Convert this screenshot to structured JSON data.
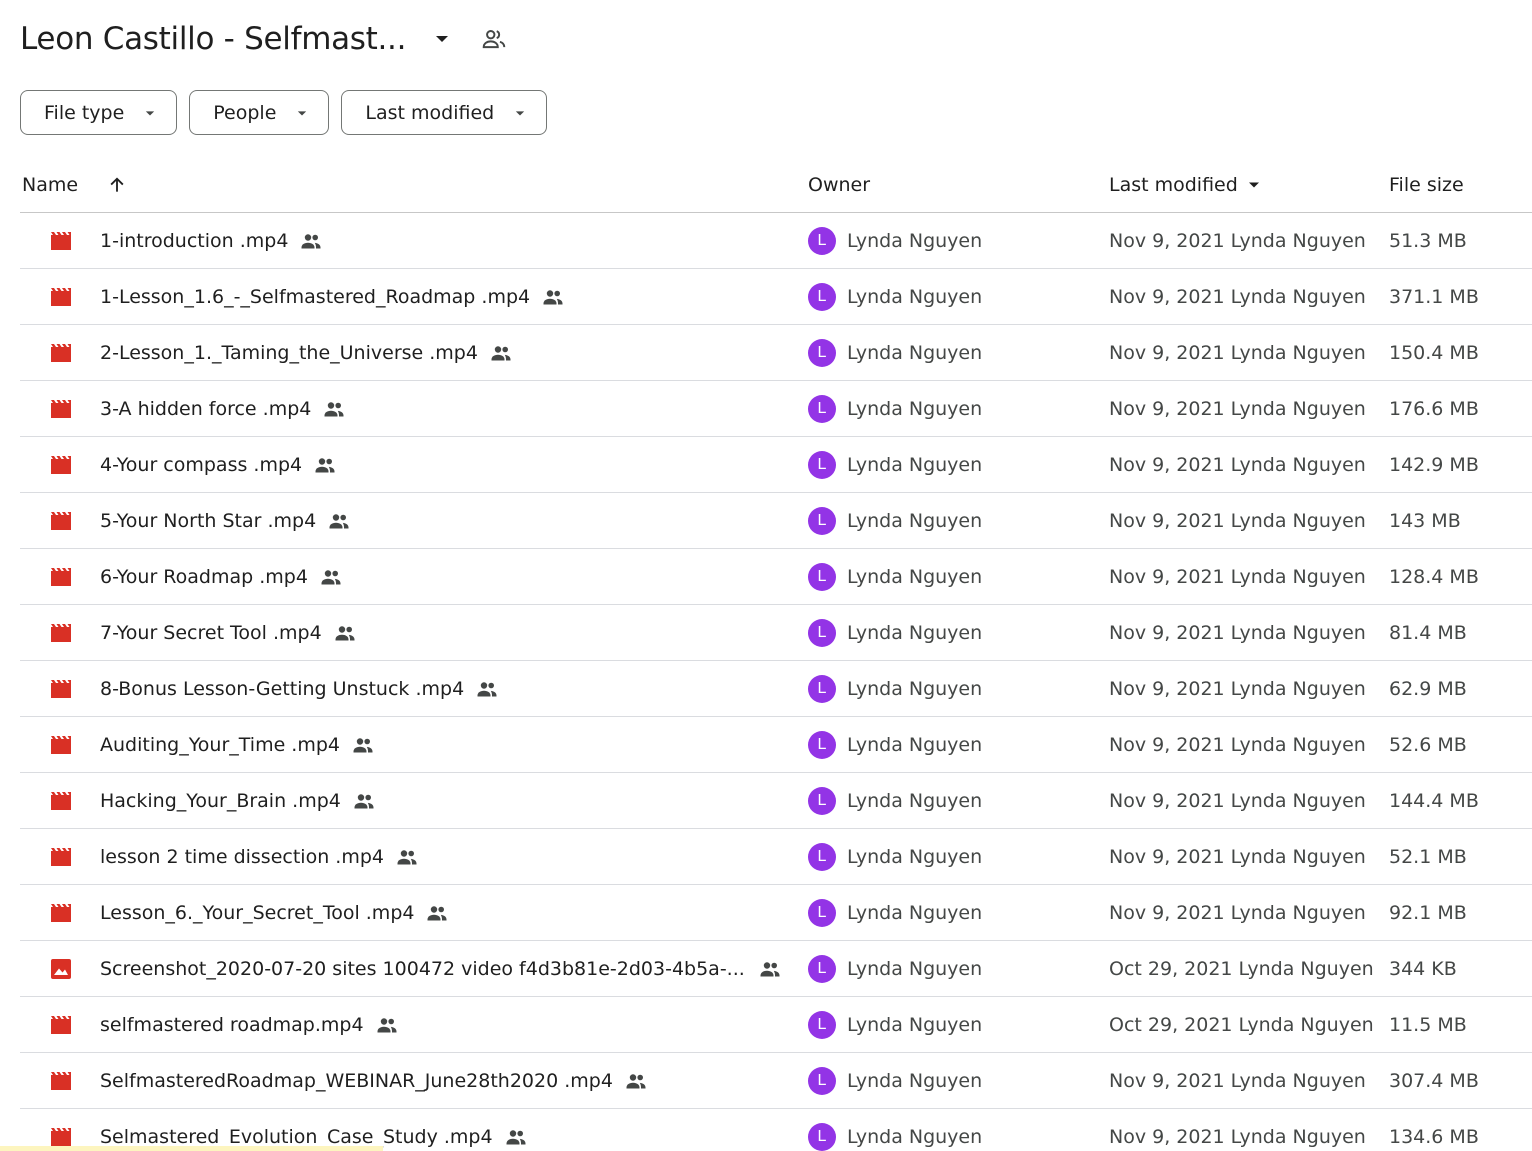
{
  "header": {
    "title": "Leon Castillo - Selfmast...",
    "icons": {
      "caret": "arrow-drop-down-icon",
      "shared": "shared-folder-people-icon"
    }
  },
  "filters": [
    {
      "label": "File type"
    },
    {
      "label": "People"
    },
    {
      "label": "Last modified"
    }
  ],
  "columns": {
    "name": "Name",
    "owner": "Owner",
    "last_modified": "Last modified",
    "file_size": "File size"
  },
  "colors": {
    "video_icon": "#d93025",
    "avatar": "#9334e6",
    "text": "#1f1f1f",
    "secondary_text": "#444746"
  },
  "files": [
    {
      "icon": "video-icon",
      "name": "1-introduction .mp4",
      "owner_initial": "L",
      "owner": "Lynda Nguyen",
      "modified": "Nov 9, 2021 Lynda Nguyen",
      "size": "51.3 MB"
    },
    {
      "icon": "video-icon",
      "name": "1-Lesson_1.6_-_Selfmastered_Roadmap .mp4",
      "owner_initial": "L",
      "owner": "Lynda Nguyen",
      "modified": "Nov 9, 2021 Lynda Nguyen",
      "size": "371.1 MB"
    },
    {
      "icon": "video-icon",
      "name": "2-Lesson_1._Taming_the_Universe .mp4",
      "owner_initial": "L",
      "owner": "Lynda Nguyen",
      "modified": "Nov 9, 2021 Lynda Nguyen",
      "size": "150.4 MB"
    },
    {
      "icon": "video-icon",
      "name": "3-A hidden force .mp4",
      "owner_initial": "L",
      "owner": "Lynda Nguyen",
      "modified": "Nov 9, 2021 Lynda Nguyen",
      "size": "176.6 MB"
    },
    {
      "icon": "video-icon",
      "name": "4-Your compass .mp4",
      "owner_initial": "L",
      "owner": "Lynda Nguyen",
      "modified": "Nov 9, 2021 Lynda Nguyen",
      "size": "142.9 MB"
    },
    {
      "icon": "video-icon",
      "name": "5-Your North Star .mp4",
      "owner_initial": "L",
      "owner": "Lynda Nguyen",
      "modified": "Nov 9, 2021 Lynda Nguyen",
      "size": "143 MB"
    },
    {
      "icon": "video-icon",
      "name": "6-Your Roadmap .mp4",
      "owner_initial": "L",
      "owner": "Lynda Nguyen",
      "modified": "Nov 9, 2021 Lynda Nguyen",
      "size": "128.4 MB"
    },
    {
      "icon": "video-icon",
      "name": "7-Your Secret Tool .mp4",
      "owner_initial": "L",
      "owner": "Lynda Nguyen",
      "modified": "Nov 9, 2021 Lynda Nguyen",
      "size": "81.4 MB"
    },
    {
      "icon": "video-icon",
      "name": "8-Bonus Lesson-Getting Unstuck .mp4",
      "owner_initial": "L",
      "owner": "Lynda Nguyen",
      "modified": "Nov 9, 2021 Lynda Nguyen",
      "size": "62.9 MB"
    },
    {
      "icon": "video-icon",
      "name": "Auditing_Your_Time .mp4",
      "owner_initial": "L",
      "owner": "Lynda Nguyen",
      "modified": "Nov 9, 2021 Lynda Nguyen",
      "size": "52.6 MB"
    },
    {
      "icon": "video-icon",
      "name": "Hacking_Your_Brain .mp4",
      "owner_initial": "L",
      "owner": "Lynda Nguyen",
      "modified": "Nov 9, 2021 Lynda Nguyen",
      "size": "144.4 MB"
    },
    {
      "icon": "video-icon",
      "name": "lesson 2 time dissection .mp4",
      "owner_initial": "L",
      "owner": "Lynda Nguyen",
      "modified": "Nov 9, 2021 Lynda Nguyen",
      "size": "52.1 MB"
    },
    {
      "icon": "video-icon",
      "name": "Lesson_6._Your_Secret_Tool .mp4",
      "owner_initial": "L",
      "owner": "Lynda Nguyen",
      "modified": "Nov 9, 2021 Lynda Nguyen",
      "size": "92.1 MB"
    },
    {
      "icon": "image-icon",
      "name": "Screenshot_2020-07-20  sites 100472 video f4d3b81e-2d03-4b5a-...",
      "owner_initial": "L",
      "owner": "Lynda Nguyen",
      "modified": "Oct 29, 2021 Lynda Nguyen",
      "size": "344 KB",
      "truncated": true
    },
    {
      "icon": "video-icon",
      "name": "selfmastered roadmap.mp4",
      "owner_initial": "L",
      "owner": "Lynda Nguyen",
      "modified": "Oct 29, 2021 Lynda Nguyen",
      "size": "11.5 MB"
    },
    {
      "icon": "video-icon",
      "name": "SelfmasteredRoadmap_WEBINAR_June28th2020 .mp4",
      "owner_initial": "L",
      "owner": "Lynda Nguyen",
      "modified": "Nov 9, 2021 Lynda Nguyen",
      "size": "307.4 MB"
    },
    {
      "icon": "video-icon",
      "name": "Selmastered_Evolution_Case_Study .mp4",
      "owner_initial": "L",
      "owner": "Lynda Nguyen",
      "modified": "Nov 9, 2021 Lynda Nguyen",
      "size": "134.6 MB"
    }
  ]
}
